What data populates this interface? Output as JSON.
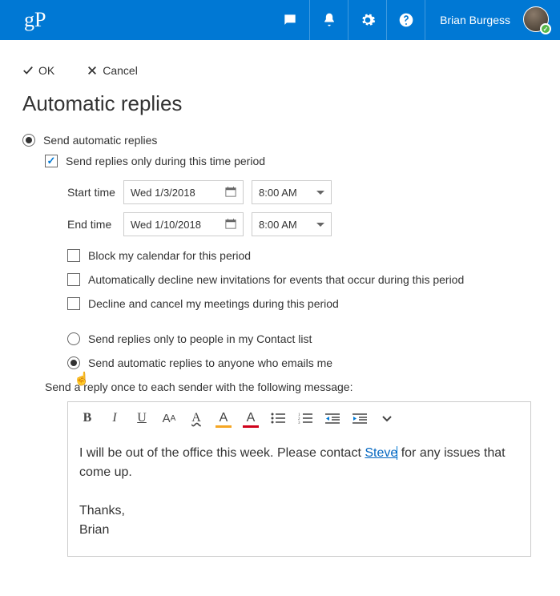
{
  "header": {
    "logo_text": "gP",
    "username": "Brian Burgess"
  },
  "actions": {
    "ok_label": "OK",
    "cancel_label": "Cancel"
  },
  "page_title": "Automatic replies",
  "send_replies_radio": {
    "label": "Send automatic replies",
    "checked": true
  },
  "time_period_check": {
    "label": "Send replies only during this time period",
    "checked": true
  },
  "schedule": {
    "start_label": "Start time",
    "start_date": "Wed 1/3/2018",
    "start_time": "8:00 AM",
    "end_label": "End time",
    "end_date": "Wed 1/10/2018",
    "end_time": "8:00 AM"
  },
  "options": {
    "block_calendar": {
      "label": "Block my calendar for this period",
      "checked": false
    },
    "decline_new": {
      "label": "Automatically decline new invitations for events that occur during this period",
      "checked": false
    },
    "decline_cancel": {
      "label": "Decline and cancel my meetings during this period",
      "checked": false
    }
  },
  "reply_scope": {
    "contacts_only": {
      "label": "Send replies only to people in my Contact list",
      "selected": false
    },
    "anyone": {
      "label": "Send automatic replies to anyone who emails me",
      "selected": true
    }
  },
  "reply_instruction": "Send a reply once to each sender with the following message:",
  "editor": {
    "toolbar": {
      "bold": "B",
      "italic": "I",
      "underline": "U"
    },
    "body_text_1": "I will be out of the office this week. Please contact ",
    "body_link": "Steve",
    "body_text_2": " for any issues that come up.",
    "closing_1": "Thanks,",
    "closing_2": "Brian"
  }
}
